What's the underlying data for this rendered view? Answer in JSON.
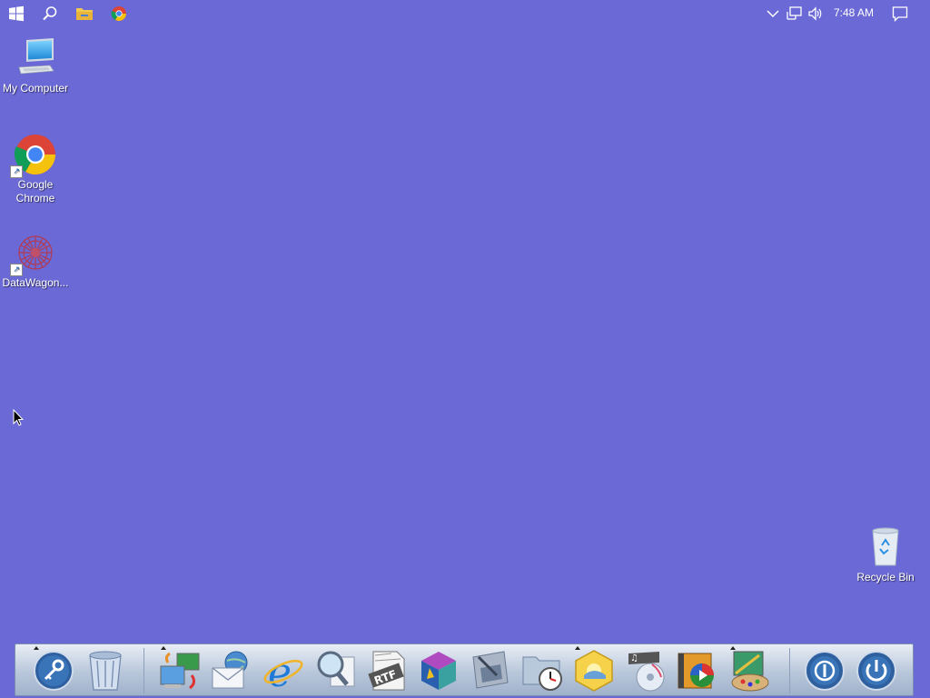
{
  "taskbar": {
    "pinned": [
      {
        "name": "windows-start-icon"
      },
      {
        "name": "search-icon"
      },
      {
        "name": "file-explorer-icon"
      },
      {
        "name": "chrome-icon"
      }
    ],
    "tray": {
      "clock": "7:48 AM"
    }
  },
  "desktop": {
    "icons": [
      {
        "label": "My Computer"
      },
      {
        "label": "Google Chrome"
      },
      {
        "label": "DataWagon..."
      },
      {
        "label": "Recycle Bin"
      }
    ]
  },
  "dock": {
    "items": [
      {
        "name": "key-icon"
      },
      {
        "name": "trash-icon"
      },
      {
        "name": "network-transfer-icon"
      },
      {
        "name": "mail-globe-icon"
      },
      {
        "name": "internet-explorer-icon"
      },
      {
        "name": "magnifier-icon"
      },
      {
        "name": "rtf-document-icon"
      },
      {
        "name": "3d-cube-icon"
      },
      {
        "name": "disk-utility-icon"
      },
      {
        "name": "folder-clock-icon"
      },
      {
        "name": "sun-hexagon-icon"
      },
      {
        "name": "music-cd-icon"
      },
      {
        "name": "media-player-icon"
      },
      {
        "name": "paint-palette-icon"
      },
      {
        "name": "logoff-icon"
      },
      {
        "name": "power-icon"
      }
    ]
  },
  "colors": {
    "desktop_background": "#6b69d6",
    "dock_gradient_top": "#e9eef6",
    "dock_gradient_bottom": "#9fb1cb"
  }
}
